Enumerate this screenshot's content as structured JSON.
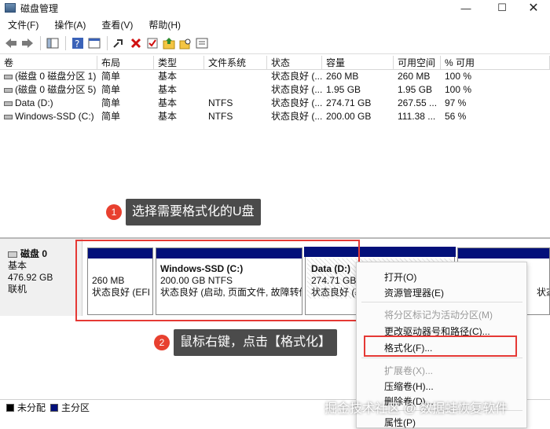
{
  "window": {
    "title": "磁盘管理",
    "minimize": "—",
    "maximize": "☐",
    "close": "✕"
  },
  "menu": [
    "文件(F)",
    "操作(A)",
    "查看(V)",
    "帮助(H)"
  ],
  "toolbar_icons": [
    "back-arrow-icon",
    "forward-arrow-icon",
    "console-tree-icon",
    "help-icon",
    "properties-icon",
    "connect-icon",
    "delete-icon",
    "check-icon",
    "folder-up-icon",
    "search-folder-icon",
    "list-view-icon"
  ],
  "table": {
    "headers": [
      "卷",
      "布局",
      "类型",
      "文件系统",
      "状态",
      "容量",
      "可用空间",
      "% 可用"
    ],
    "rows": [
      [
        "(磁盘 0 磁盘分区 1)",
        "简单",
        "基本",
        "",
        "状态良好 (...",
        "260 MB",
        "260 MB",
        "100 %"
      ],
      [
        "(磁盘 0 磁盘分区 5)",
        "简单",
        "基本",
        "",
        "状态良好 (...",
        "1.95 GB",
        "1.95 GB",
        "100 %"
      ],
      [
        "Data (D:)",
        "简单",
        "基本",
        "NTFS",
        "状态良好 (...",
        "274.71 GB",
        "267.55 ...",
        "97 %"
      ],
      [
        "Windows-SSD (C:)",
        "简单",
        "基本",
        "NTFS",
        "状态良好 (...",
        "200.00 GB",
        "111.38 ...",
        "56 %"
      ]
    ]
  },
  "annotations": {
    "step1_num": "1",
    "step1_text": "选择需要格式化的U盘",
    "step2_num": "2",
    "step2_text": "鼠标右键，点击【格式化】"
  },
  "disk": {
    "name": "磁盘 0",
    "type": "基本",
    "size": "476.92 GB",
    "status": "联机"
  },
  "partitions": [
    {
      "name": "",
      "size": "260 MB",
      "status": "状态良好 (EFI 系"
    },
    {
      "name": "Windows-SSD  (C:)",
      "size": "200.00 GB NTFS",
      "status": "状态良好 (启动, 页面文件, 故障转储"
    },
    {
      "name": "Data  (D:)",
      "size": "274.71 GB",
      "status": "状态良好 (基"
    },
    {
      "name": "",
      "size": "",
      "status": "状态良好 (恢"
    }
  ],
  "legend": {
    "unallocated": "未分配",
    "primary": "主分区"
  },
  "context_menu": {
    "open": "打开(O)",
    "explorer": "资源管理器(E)",
    "mark_active": "将分区标记为活动分区(M)",
    "change_letter": "更改驱动器号和路径(C)...",
    "format": "格式化(F)...",
    "extend": "扩展卷(X)...",
    "shrink": "压缩卷(H)...",
    "delete": "删除卷(D)...",
    "properties": "属性(P)"
  },
  "watermark": "掘金技术社区 @ 数据蛙恢复软件",
  "colors": {
    "primary_partition": "#03107a",
    "highlight_red": "#e53935",
    "bubble_bg": "#4b4b4b"
  }
}
